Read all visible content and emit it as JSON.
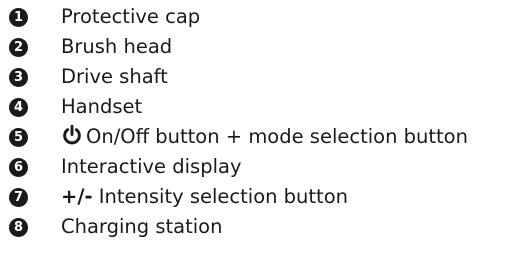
{
  "parts": [
    {
      "number": "1",
      "label": "Protective cap"
    },
    {
      "number": "2",
      "label": "Brush head"
    },
    {
      "number": "3",
      "label": "Drive shaft"
    },
    {
      "number": "4",
      "label": "Handset"
    },
    {
      "number": "5",
      "icon": "power-icon",
      "label": "On/Off button + mode selection button"
    },
    {
      "number": "6",
      "label": "Interactive display"
    },
    {
      "number": "7",
      "prefix": "+/-",
      "label": " Intensity selection button"
    },
    {
      "number": "8",
      "label": "Charging station"
    }
  ]
}
